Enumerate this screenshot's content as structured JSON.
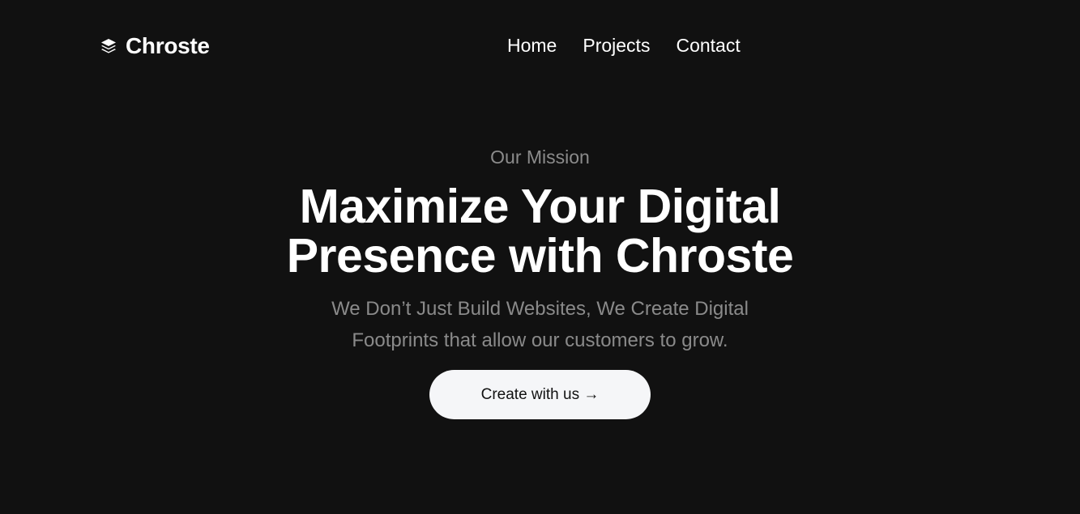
{
  "brand": {
    "name": "Chroste",
    "icon": "layers-icon"
  },
  "nav": {
    "items": [
      {
        "label": "Home"
      },
      {
        "label": "Projects"
      },
      {
        "label": "Contact"
      }
    ]
  },
  "hero": {
    "eyebrow": "Our Mission",
    "headline": "Maximize Your Digital Presence with Chroste",
    "subtext": "We Don’t Just Build Websites, We Create Digital Footprints that allow our customers to grow.",
    "cta_label": "Create with us →"
  },
  "colors": {
    "background": "#111111",
    "text_primary": "#ffffff",
    "text_muted": "#8a8a8a",
    "cta_background": "#f5f6f8"
  }
}
